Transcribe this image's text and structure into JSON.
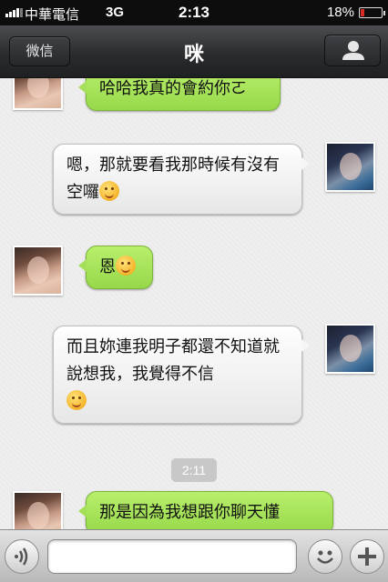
{
  "status_bar": {
    "carrier": "中華電信",
    "network": "3G",
    "time": "2:13",
    "battery_percent": "18%",
    "battery_color": "#d72a20"
  },
  "nav": {
    "back_label": "微信",
    "title": "咪",
    "profile_icon": "person-icon"
  },
  "messages": [
    {
      "sender": "her",
      "side": "left",
      "text": "哈哈我真的會約你ㄛ"
    },
    {
      "sender": "him",
      "side": "right",
      "text": "嗯，那就要看我那時候有沒有空囉",
      "emoji": "thinking-face-emoji"
    },
    {
      "sender": "her",
      "side": "left",
      "text": "恩",
      "emoji": "smiling-face-emoji"
    },
    {
      "sender": "him",
      "side": "right",
      "text": "而且妳連我明子都還不知道就說想我，我覺得不信",
      "emoji": "kissing-face-emoji"
    },
    {
      "sender": "her",
      "side": "left",
      "text": "那是因為我想跟你聊天懂"
    }
  ],
  "timestamp": "2:11",
  "input_bar": {
    "voice_icon": "voice-icon",
    "emoji_icon": "smiley-icon",
    "plus_icon": "plus-icon",
    "placeholder": ""
  },
  "colors": {
    "outgoing_bubble": "#a6e05a",
    "incoming_bubble": "#f4f4f4"
  }
}
